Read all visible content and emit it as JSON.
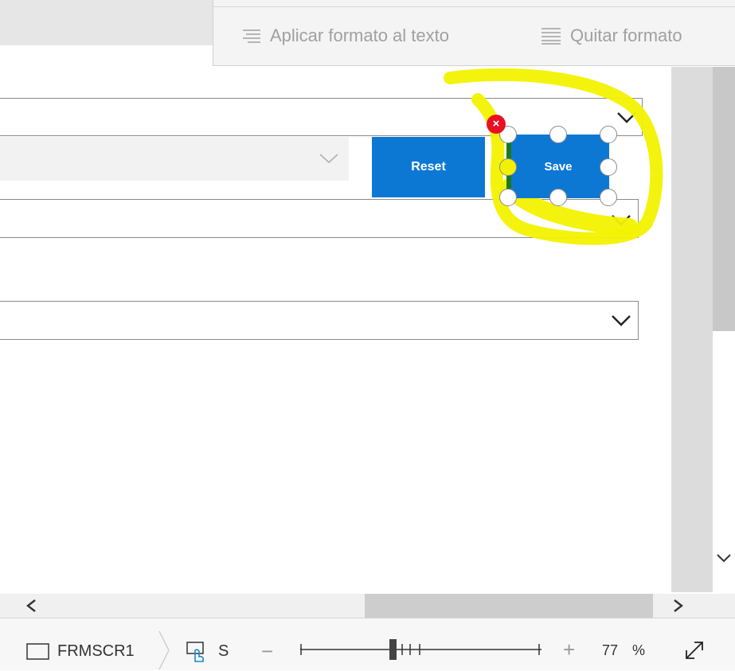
{
  "toolbar": {
    "format_text": "Aplicar formato al texto",
    "clear_format": "Quitar formato"
  },
  "buttons": {
    "reset_label": "Reset",
    "save_label": "Save"
  },
  "statusbar": {
    "screen_name": "FRMSCR1",
    "selected_prefix": "S",
    "zoom_minus": "−",
    "zoom_plus": "+",
    "zoom_value": "77",
    "zoom_unit": "%"
  },
  "colors": {
    "button_blue": "#0d78d4",
    "highlight_yellow": "#f2f200",
    "delete_red": "#e81123"
  }
}
